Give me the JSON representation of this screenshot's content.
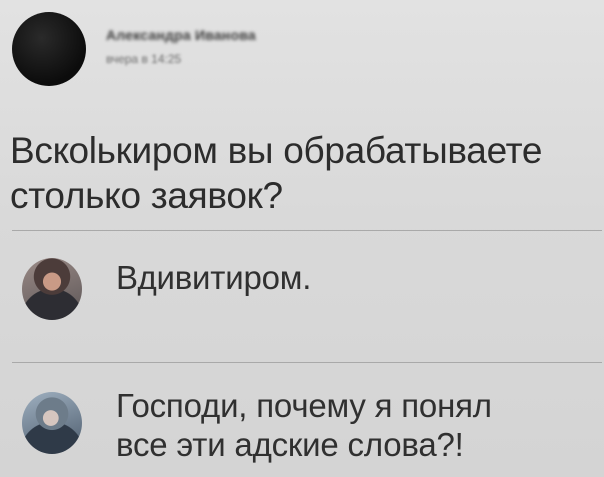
{
  "post": {
    "author": "Александра Иванова",
    "meta": "вчера в 14:25",
    "text": "Вскolькиром вы обрабатываете\nстолько заявок?"
  },
  "comments": [
    {
      "text": "Вдивитиром."
    },
    {
      "text": "Господи, почему я понял\nвсе эти адские слова?!"
    }
  ]
}
